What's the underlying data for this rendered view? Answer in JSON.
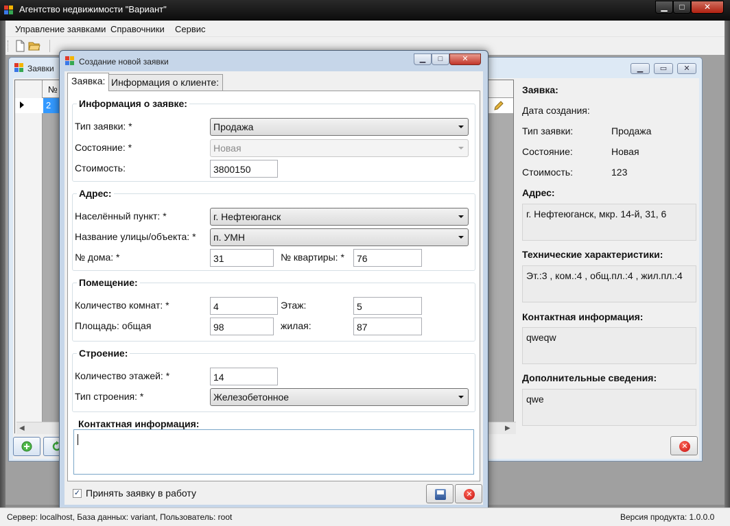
{
  "main_window": {
    "title": "Агентство недвижимости \"Вариант\"",
    "controls": {
      "minimize": "▁",
      "maximize": "□",
      "close": "✕"
    }
  },
  "menu": {
    "items": [
      "Управление заявками",
      "Справочники",
      "Сервис"
    ]
  },
  "toolbar": {
    "icons": [
      "new-document-icon",
      "open-folder-icon"
    ]
  },
  "child_window": {
    "title": "Заявки",
    "grid": {
      "header_number": "№",
      "selected_row_value": "2"
    }
  },
  "details": {
    "heading_request": "Заявка:",
    "created_label": "Дата создания:",
    "created_value": "",
    "type_label": "Тип заявки:",
    "type_value": "Продажа",
    "state_label": "Состояние:",
    "state_value": "Новая",
    "cost_label": "Стоимость:",
    "cost_value": "123",
    "address_heading": "Адрес:",
    "address_value": "г. Нефтеюганск, мкр. 14-й, 31, 6",
    "tech_heading": "Технические характеристики:",
    "tech_value": "Эт.:3 , ком.:4 , общ.пл.:4 , жил.пл.:4",
    "contact_heading": "Контактная информация:",
    "contact_value": "qweqw",
    "extra_heading": "Дополнительные сведения:",
    "extra_value": "qwe"
  },
  "dialog": {
    "title": "Создание новой заявки",
    "tabs": [
      "Заявка:",
      "Информация о клиенте:"
    ],
    "request_group": {
      "title": "Информация о заявке:",
      "type_label": "Тип заявки: *",
      "type_value": "Продажа",
      "state_label": "Состояние: *",
      "state_value": "Новая",
      "cost_label": "Стоимость:",
      "cost_value": "3800150"
    },
    "address_group": {
      "title": "Адрес:",
      "city_label": "Населённый пункт: *",
      "city_value": "г. Нефтеюганск",
      "street_label": "Название улицы/объекта: *",
      "street_value": "п. УМН",
      "house_label": "№ дома: *",
      "house_value": "31",
      "apt_label": "№ квартиры: *",
      "apt_value": "76"
    },
    "room_group": {
      "title": "Помещение:",
      "rooms_label": "Количество комнат: *",
      "rooms_value": "4",
      "floor_label": "Этаж:",
      "floor_value": "5",
      "area_label": "Площадь: общая",
      "area_value": "98",
      "living_label": "жилая:",
      "living_value": "87"
    },
    "building_group": {
      "title": "Строение:",
      "floors_label": "Количество этажей: *",
      "floors_value": "14",
      "type_label": "Тип строения: *",
      "type_value": "Железобетонное"
    },
    "contact_group": {
      "title": "Контактная информация:",
      "value": ""
    },
    "accept_label": "Принять заявку в работу",
    "accept_checked": true
  },
  "status": {
    "left": "Сервер: localhost, База данных: variant, Пользователь: root",
    "right": "Версия продукта: 1.0.0.0"
  },
  "colors": {
    "selection": "#3399ff",
    "close_red": "#c40e0e",
    "title_bar": "#0c0c0c"
  }
}
